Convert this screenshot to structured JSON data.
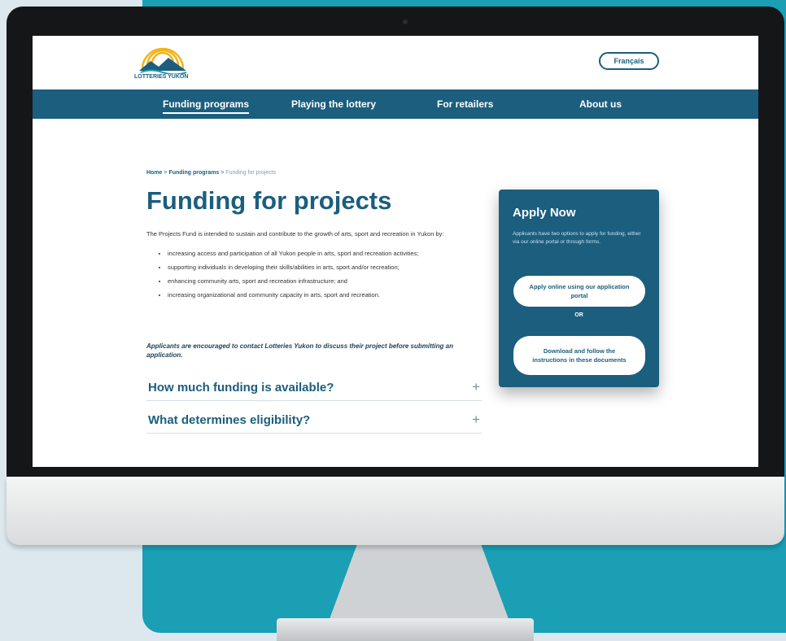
{
  "header": {
    "logo_text": "LOTTERIES YUKON",
    "lang_button": "Français"
  },
  "nav": {
    "items": [
      {
        "label": "Funding programs",
        "active": true
      },
      {
        "label": "Playing the lottery"
      },
      {
        "label": "For retailers"
      },
      {
        "label": "About us"
      }
    ]
  },
  "breadcrumb": {
    "home": "Home",
    "sep": ">",
    "section": "Funding programs",
    "current": "Funding for projects"
  },
  "page": {
    "title": "Funding for projects",
    "intro": "The Projects Fund is intended to sustain and contribute to the growth of arts, sport and recreation in Yukon by:",
    "bullets": [
      "increasing access and participation of all Yukon people in arts, sport and recreation activities;",
      "supporting individuals in developing their skills/abilities in arts, sport and/or recreation;",
      "enhancing community arts, sport and recreation infrastructure; and",
      "increasing organizational and community capacity in arts, sport and recreation."
    ],
    "emphasis": "Applicants are encouraged to contact Lotteries Yukon to discuss their project before submitting an application."
  },
  "faq": [
    {
      "question": "How much funding is available?",
      "icon": "plus-icon"
    },
    {
      "question": "What determines eligibility?",
      "icon": "plus-icon"
    }
  ],
  "apply": {
    "title": "Apply Now",
    "desc": "Applicants have two options to apply for funding, either via our online portal or through forms.",
    "button_online": "Apply online using our application portal",
    "or": "OR",
    "button_docs": "Download and follow the instructions in these documents"
  },
  "colors": {
    "brand": "#1b5e7e",
    "background_accent": "#1a9fb5"
  }
}
